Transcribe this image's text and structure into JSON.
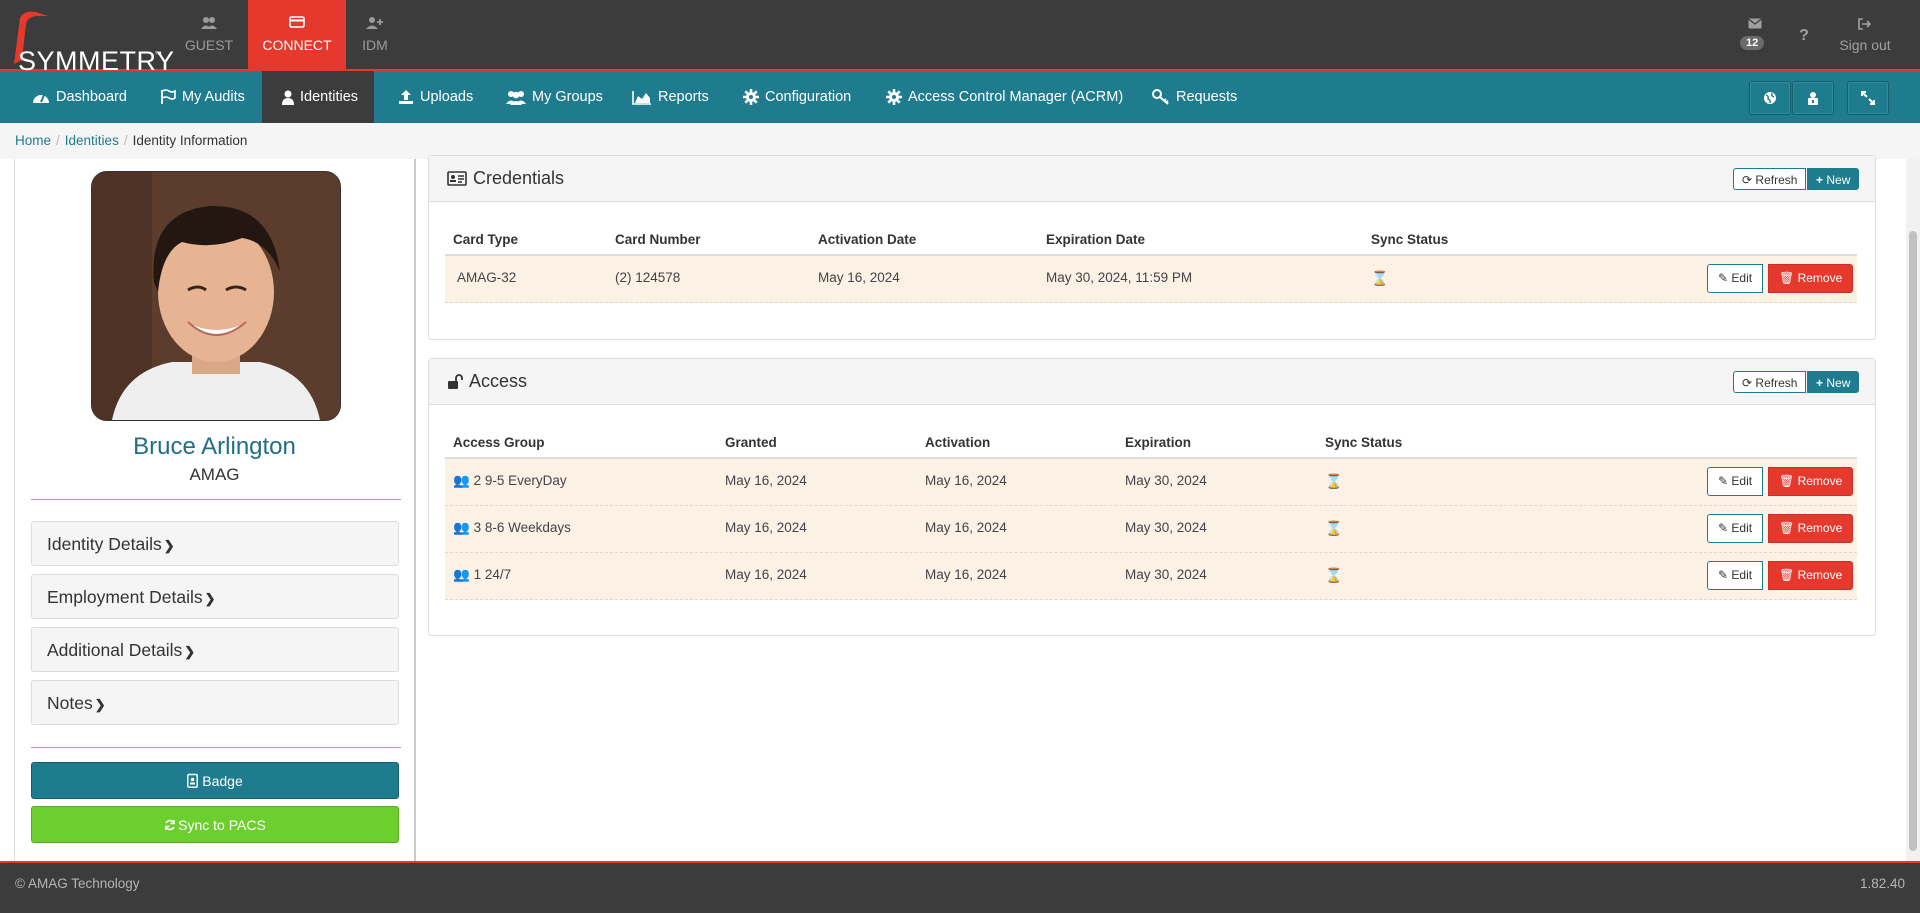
{
  "brand": {
    "logo_text": "SYMMETRY",
    "tm": "™"
  },
  "topnav": [
    {
      "label": "GUEST",
      "icon": "users-icon"
    },
    {
      "label": "CONNECT",
      "icon": "card-icon",
      "active": true
    },
    {
      "label": "IDM",
      "icon": "user-plus-icon"
    }
  ],
  "header_tools": {
    "mail_count": "12",
    "help": "?",
    "signout": "Sign out"
  },
  "nav": [
    {
      "label": "Dashboard",
      "icon": "dashboard-icon"
    },
    {
      "label": "My Audits",
      "icon": "flag-icon"
    },
    {
      "label": "Identities",
      "icon": "user-icon",
      "active": true
    },
    {
      "label": "Uploads",
      "icon": "upload-icon"
    },
    {
      "label": "My Groups",
      "icon": "users-icon"
    },
    {
      "label": "Reports",
      "icon": "area-chart-icon"
    },
    {
      "label": "Configuration",
      "icon": "gear-icon"
    },
    {
      "label": "Access Control Manager (ACRM)",
      "icon": "gear-icon"
    },
    {
      "label": "Requests",
      "icon": "key-icon"
    }
  ],
  "breadcrumb": {
    "home": "Home",
    "identities": "Identities",
    "current": "Identity Information"
  },
  "identity": {
    "name": "Bruce Arlington",
    "org": "AMAG"
  },
  "sections": [
    "Identity Details",
    "Employment Details",
    "Additional Details",
    "Notes"
  ],
  "buttons": {
    "badge": "Badge",
    "sync": "Sync to PACS",
    "refresh": "Refresh",
    "new": "New",
    "edit": "Edit",
    "remove": "Remove"
  },
  "credentials": {
    "title": "Credentials",
    "columns": [
      "Card Type",
      "Card Number",
      "Activation Date",
      "Expiration Date",
      "Sync Status"
    ],
    "rows": [
      {
        "card_type": "AMAG-32",
        "card_number": "(2) 124578",
        "activation": "May 16, 2024",
        "expiration": "May 30, 2024, 11:59 PM"
      }
    ]
  },
  "access": {
    "title": "Access",
    "columns": [
      "Access Group",
      "Granted",
      "Activation",
      "Expiration",
      "Sync Status"
    ],
    "rows": [
      {
        "group": "2 9-5 EveryDay",
        "granted": "May 16, 2024",
        "activation": "May 16, 2024",
        "expiration": "May 30, 2024"
      },
      {
        "group": "3 8-6 Weekdays",
        "granted": "May 16, 2024",
        "activation": "May 16, 2024",
        "expiration": "May 30, 2024"
      },
      {
        "group": "1 24/7",
        "granted": "May 16, 2024",
        "activation": "May 16, 2024",
        "expiration": "May 30, 2024"
      }
    ]
  },
  "footer": {
    "copyright": "© AMAG Technology",
    "version": "1.82.40"
  },
  "colors": {
    "brand_red": "#e5392e",
    "teal": "#1f7c8e",
    "dark": "#3c3c3c",
    "green": "#6ccf2d"
  }
}
